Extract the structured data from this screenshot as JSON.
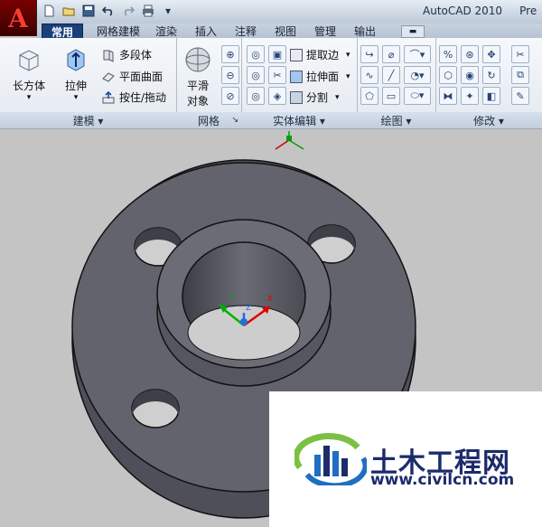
{
  "title_bar": {
    "app_title": "AutoCAD 2010",
    "title_suffix": "Pre",
    "app_button_letter": "A",
    "quick_access": [
      "new-icon",
      "open-icon",
      "save-icon",
      "undo-icon",
      "redo-icon",
      "print-icon",
      "dropdown-icon"
    ]
  },
  "tabs": [
    {
      "label": "常用",
      "active": true
    },
    {
      "label": "网格建模",
      "active": false
    },
    {
      "label": "渲染",
      "active": false
    },
    {
      "label": "插入",
      "active": false
    },
    {
      "label": "注释",
      "active": false
    },
    {
      "label": "视图",
      "active": false
    },
    {
      "label": "管理",
      "active": false
    },
    {
      "label": "输出",
      "active": false
    }
  ],
  "ribbon": {
    "modeling": {
      "title": "建模 ▾",
      "box_label": "长方体",
      "box_dropdown": "▾",
      "extrude_label": "拉伸",
      "extrude_dropdown": "▾",
      "polysolid_label": "多段体",
      "planesurf_label": "平面曲面",
      "presspull_label": "按住/拖动"
    },
    "mesh": {
      "title": "网格",
      "smooth_label_1": "平滑",
      "smooth_label_2": "对象",
      "corner_mark": "↘"
    },
    "solid_edit": {
      "title": "实体编辑 ▾",
      "extract_label": "提取边",
      "extrude_face_label": "拉伸面",
      "separate_label": "分割"
    },
    "draw": {
      "title": "绘图 ▾"
    },
    "modify": {
      "title": "修改 ▾"
    }
  },
  "viewport": {
    "ucs_labels": {
      "y": "Y",
      "z": "Z",
      "x": "X"
    },
    "colors": {
      "face": "#5e5f69",
      "face_light": "#6d6e78",
      "edge": "#111111",
      "hole": "#cfcfcf",
      "background": "#c4c4c4"
    }
  },
  "watermark": {
    "brand": "土木工程网",
    "url": "www.civilcn.com"
  }
}
